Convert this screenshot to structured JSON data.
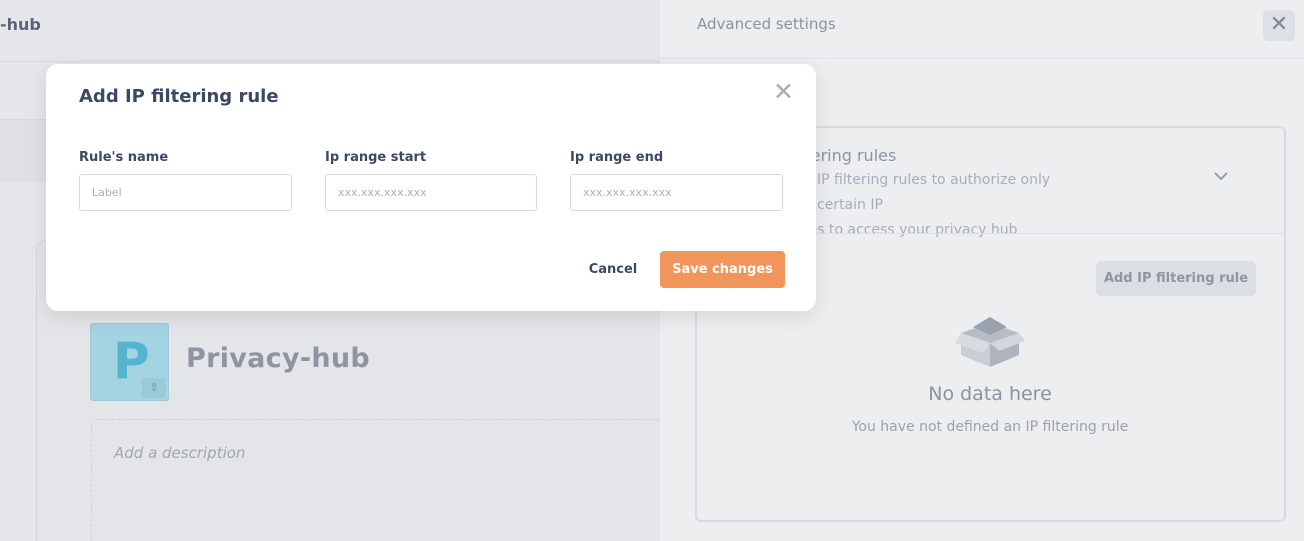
{
  "background": {
    "app_name": "-hub",
    "hub_name": "Privacy-hub",
    "logo_letter": "P",
    "description_placeholder": "Add a description"
  },
  "panel": {
    "title": "Advanced settings",
    "close_icon": "close-icon",
    "section": {
      "title": "ltering rules",
      "description": "IP filtering rules to authorize only certain IP\nresses to access your privacy hub",
      "chevron_icon": "chevron-down-icon"
    },
    "add_rule_label": "Add IP filtering rule",
    "empty_state": {
      "icon": "empty-box-icon",
      "title": "No data here",
      "subtitle": "You have not defined an IP filtering rule"
    }
  },
  "modal": {
    "title": "Add IP filtering rule",
    "close_icon": "close-icon",
    "fields": [
      {
        "label": "Rule's name",
        "placeholder": "Label",
        "value": ""
      },
      {
        "label": "Ip range start",
        "placeholder": "xxx.xxx.xxx.xxx",
        "value": ""
      },
      {
        "label": "Ip range end",
        "placeholder": "xxx.xxx.xxx.xxx",
        "value": ""
      }
    ],
    "cancel_label": "Cancel",
    "save_label": "Save changes"
  },
  "colors": {
    "primary_text": "#3b4963",
    "save_button": "#f2955a",
    "logo_tile": "#a4d3e1",
    "logo_letter": "#55b5cf"
  }
}
